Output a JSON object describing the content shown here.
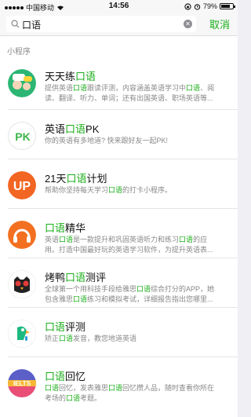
{
  "status": {
    "carrier": "中国移动",
    "time": "14:56",
    "battery": "79%",
    "battery_level": 0.79
  },
  "search": {
    "query": "口语",
    "cancel": "取消"
  },
  "section": {
    "title": "小程序"
  },
  "items": [
    {
      "title": [
        "天天练",
        "口语",
        ""
      ],
      "desc": [
        [
          "提供英语",
          "口语",
          "跟读评测，内容涵盖英语学习中",
          "口语",
          "、阅读、翻译、听力、单词；还有出国英语、职场英语等..."
        ]
      ]
    },
    {
      "title": [
        "英语",
        "口语",
        "PK"
      ],
      "desc": [
        [
          "你的英语有多地道? 快来跟好友一起PK!"
        ]
      ]
    },
    {
      "title": [
        "21天",
        "口语",
        "计划"
      ],
      "desc": [
        [
          "帮助你坚持每天学习",
          "口语",
          "的打卡小程序。"
        ]
      ]
    },
    {
      "title": [
        "",
        "口语",
        "精华"
      ],
      "desc": [
        [
          "英语",
          "口语",
          "是一款提升和巩固英语听力和练习",
          "口语",
          "的应用。打造中国最好玩的英语学习软件，为提升英语表..."
        ]
      ]
    },
    {
      "title": [
        "烤鸭",
        "口语",
        "测评"
      ],
      "desc": [
        [
          "全球第一个用科技手段给雅思",
          "口语",
          "综合打分的APP，她包含雅思",
          "口语",
          "练习和模拟考试，详细报告指出您哪里..."
        ]
      ]
    },
    {
      "title": [
        "",
        "口语",
        "评测"
      ],
      "desc": [
        [
          "矫正",
          "口语",
          "发音，教您地道英语"
        ]
      ]
    },
    {
      "title": [
        "",
        "口语",
        "回忆"
      ],
      "desc": [
        [
          "",
          "口语",
          "回忆，发表雅思",
          "口语",
          "回忆攒人品，随时查看你所在考场的",
          "口语",
          "考题。"
        ]
      ]
    }
  ],
  "icons": [
    {
      "name": "tiantianlian-app-icon",
      "text": ""
    },
    {
      "name": "pk-app-icon",
      "text": "PK"
    },
    {
      "name": "21-days-app-icon",
      "text": "UP"
    },
    {
      "name": "headphones-app-icon",
      "text": ""
    },
    {
      "name": "owl-app-icon",
      "text": ""
    },
    {
      "name": "parrot-app-icon",
      "text": ""
    },
    {
      "name": "ielts-app-icon",
      "text": "IELTS"
    }
  ]
}
